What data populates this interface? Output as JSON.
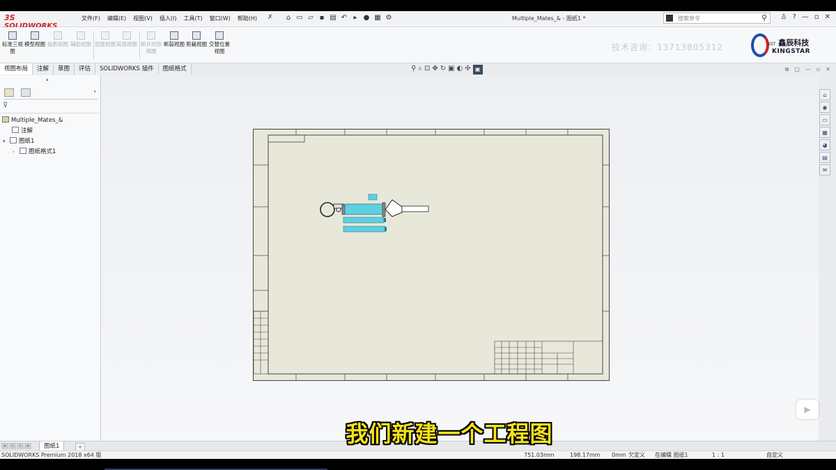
{
  "app": {
    "logo": "SOLIDWORKS",
    "logo_mark": "3S",
    "menu": [
      "文件(F)",
      "编辑(E)",
      "视图(V)",
      "插入(I)",
      "工具(T)",
      "窗口(W)",
      "帮助(H)"
    ],
    "doc_title": "Multiple_Mates_& - 图纸1 *",
    "search_placeholder": "搜索命令",
    "window_controls": [
      "—",
      "▫",
      "✕"
    ],
    "help_label": "?"
  },
  "ribbon": {
    "buttons": [
      {
        "label": "标准三视图",
        "enabled": true
      },
      {
        "label": "模型视图",
        "enabled": true
      },
      {
        "label": "投影视图",
        "enabled": false
      },
      {
        "label": "辅助视图",
        "enabled": false
      },
      {
        "label": "剖面视图",
        "enabled": false
      },
      {
        "label": "局部视图",
        "enabled": false
      },
      {
        "label": "断开的剖视图",
        "enabled": false
      },
      {
        "label": "断裂视图",
        "enabled": true
      },
      {
        "label": "剪裁视图",
        "enabled": true
      },
      {
        "label": "交替位置视图",
        "enabled": true
      }
    ],
    "watermark": "技术咨询：13713805312",
    "brand": {
      "prefix": "KST",
      "name": "鑫辰科技",
      "sub": "KINGSTAR"
    }
  },
  "tabs": [
    "视图布局",
    "注解",
    "草图",
    "评估",
    "SOLIDWORKS 插件",
    "图纸格式"
  ],
  "tree": {
    "root": "Multiple_Mates_&",
    "items": [
      {
        "label": "注解",
        "indent": 1
      },
      {
        "label": "图纸1",
        "indent": 1
      },
      {
        "label": "图纸格式1",
        "indent": 2
      }
    ]
  },
  "subtitle": "我们新建一个工程图",
  "sheet_tab": "图纸1",
  "status": {
    "product": "SOLIDWORKS Premium 2018 x64 版",
    "x": "751.03mm",
    "y": "198.17mm",
    "z": "0mm",
    "state": "欠定义",
    "editing": "在编辑 图纸1",
    "scale": "1 : 1",
    "units": "自定义"
  }
}
